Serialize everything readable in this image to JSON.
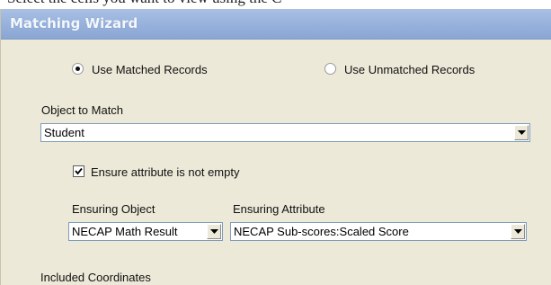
{
  "document": {
    "text": "Select the cells you want to view using the C"
  },
  "window": {
    "title": "Matching Wizard"
  },
  "record_mode": {
    "matched_label": "Use Matched Records",
    "unmatched_label": "Use Unmatched Records",
    "selected": "matched"
  },
  "object_to_match": {
    "label": "Object to Match",
    "value": "Student"
  },
  "ensure_attribute": {
    "label": "Ensure attribute is not empty",
    "checked": true
  },
  "ensuring_object": {
    "label": "Ensuring Object",
    "value": "NECAP Math Result"
  },
  "ensuring_attribute": {
    "label": "Ensuring Attribute",
    "value": "NECAP Sub-scores:Scaled Score"
  },
  "included_coordinates": {
    "label": "Included Coordinates"
  },
  "icons": {
    "radio_selected": "radio-selected-icon",
    "radio_unselected": "radio-unselected-icon",
    "checkbox_checked": "checkmark-icon",
    "dropdown": "chevron-down-icon"
  }
}
